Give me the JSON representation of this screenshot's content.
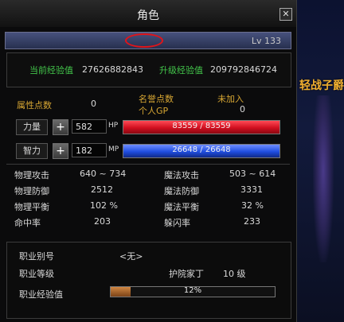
{
  "window": {
    "title": "角色",
    "close_glyph": "✕"
  },
  "character": {
    "name_label": "",
    "level_label": "Lv 133"
  },
  "experience": {
    "current_label": "当前经验值",
    "current_value": "27626882843",
    "upgrade_label": "升级经验值",
    "upgrade_value": "209792846724"
  },
  "points": {
    "attr_label": "属性点数",
    "attr_value": "0",
    "honor_label": "名誉点数",
    "honor_value": "未加入",
    "gp_label": "个人GP",
    "gp_value": "0"
  },
  "stats": {
    "str": {
      "label": "力量",
      "value": "582",
      "bar_tag": "HP",
      "bar_text": "83559 / 83559",
      "fill_fraction": 1.0,
      "color": "#d10f1f"
    },
    "int": {
      "label": "智力",
      "value": "182",
      "bar_tag": "MP",
      "bar_text": "26648 / 26648",
      "fill_fraction": 1.0,
      "color": "#1f4ee0"
    }
  },
  "combat": {
    "patk_label": "物理攻击",
    "patk_value": "640 ~ 734",
    "matk_label": "魔法攻击",
    "matk_value": "503 ~ 614",
    "pdef_label": "物理防御",
    "pdef_value": "2512",
    "mdef_label": "魔法防御",
    "mdef_value": "3331",
    "pbal_label": "物理平衡",
    "pbal_value": "102 %",
    "mbal_label": "魔法平衡",
    "mbal_value": "32 %",
    "hit_label": "命中率",
    "hit_value": "203",
    "dodge_label": "躲闪率",
    "dodge_value": "233"
  },
  "job": {
    "title_label": "职业别号",
    "title_value": "<无>",
    "level_label": "职业等级",
    "level_name": "护院家丁",
    "level_value": "10 级",
    "exp_label": "职业经验值",
    "exp_percent": 12,
    "exp_text": "12%"
  },
  "scene": {
    "overlay_text": "轻战子爵"
  },
  "colors": {
    "green": "#43c64b",
    "gold": "#d8a733",
    "hp": "#d10f1f",
    "mp": "#1f4ee0"
  }
}
